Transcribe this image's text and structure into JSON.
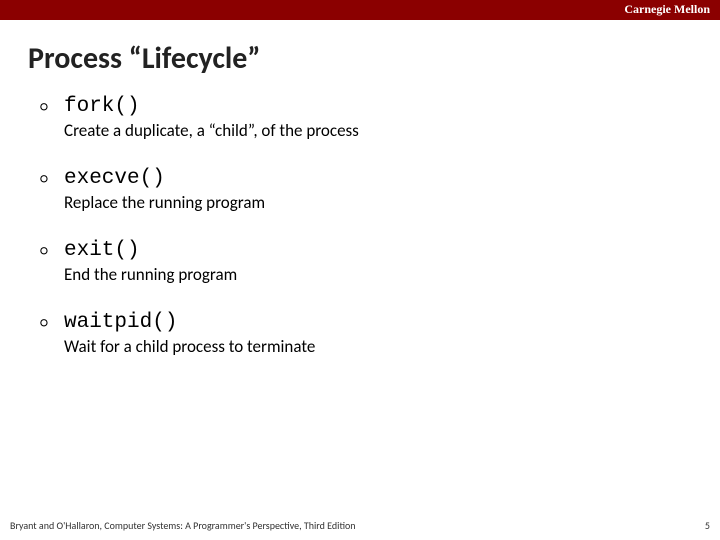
{
  "brand": "Carnegie Mellon",
  "title": "Process “Lifecycle”",
  "items": [
    {
      "fn": "fork()",
      "desc": "Create a duplicate, a “child”, of the process"
    },
    {
      "fn": "execve()",
      "desc": "Replace the running program"
    },
    {
      "fn": "exit()",
      "desc": "End the running program"
    },
    {
      "fn": "waitpid()",
      "desc": "Wait for a child process to terminate"
    }
  ],
  "footer_left": "Bryant and O'Hallaron, Computer Systems: A Programmer's Perspective, Third Edition",
  "footer_right": "5"
}
